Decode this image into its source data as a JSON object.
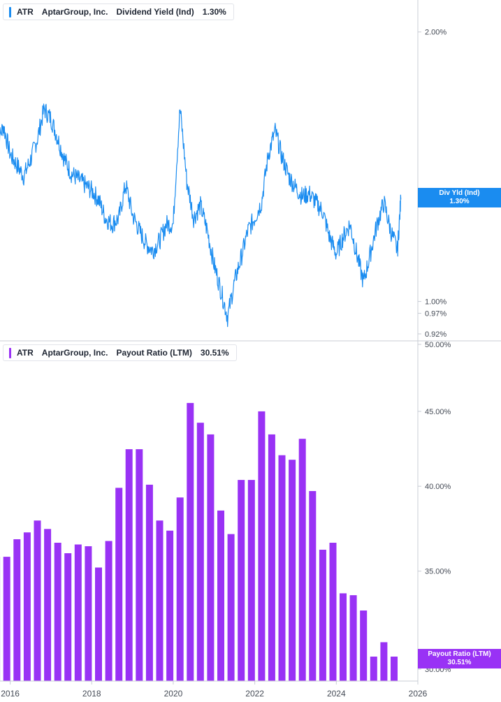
{
  "colors": {
    "yield": "#1a8cf0",
    "payout": "#9932f5",
    "axis": "#c8ccd4",
    "text": "#1f2633",
    "tick_text": "#444a55"
  },
  "top_panel": {
    "ticker": "ATR",
    "company": "AptarGroup, Inc.",
    "metric": "Dividend Yield (Ind)",
    "value": "1.30%",
    "badge_line1": "Div Yld (Ind)",
    "badge_line2": "1.30%"
  },
  "bottom_panel": {
    "ticker": "ATR",
    "company": "AptarGroup, Inc.",
    "metric": "Payout Ratio (LTM)",
    "value": "30.51%",
    "badge_line1": "Payout Ratio (LTM)",
    "badge_line2": "30.51%"
  },
  "chart_data": [
    {
      "type": "line",
      "title": "Dividend Yield (Ind)",
      "series": [
        {
          "name": "Dividend Yield (Ind)",
          "points": [
            [
              "2015-09",
              1.5
            ],
            [
              "2015-11",
              1.57
            ],
            [
              "2016-01",
              1.46
            ],
            [
              "2016-03",
              1.42
            ],
            [
              "2016-05",
              1.38
            ],
            [
              "2016-07",
              1.44
            ],
            [
              "2016-09",
              1.52
            ],
            [
              "2016-11",
              1.64
            ],
            [
              "2017-01",
              1.6
            ],
            [
              "2017-03",
              1.52
            ],
            [
              "2017-05",
              1.44
            ],
            [
              "2017-07",
              1.39
            ],
            [
              "2017-09",
              1.37
            ],
            [
              "2017-11",
              1.35
            ],
            [
              "2018-01",
              1.33
            ],
            [
              "2018-03",
              1.3
            ],
            [
              "2018-05",
              1.24
            ],
            [
              "2018-07",
              1.22
            ],
            [
              "2018-09",
              1.24
            ],
            [
              "2018-11",
              1.35
            ],
            [
              "2019-01",
              1.25
            ],
            [
              "2019-03",
              1.2
            ],
            [
              "2019-05",
              1.16
            ],
            [
              "2019-07",
              1.14
            ],
            [
              "2019-09",
              1.17
            ],
            [
              "2019-11",
              1.22
            ],
            [
              "2020-01",
              1.22
            ],
            [
              "2020-03",
              1.64
            ],
            [
              "2020-05",
              1.36
            ],
            [
              "2020-07",
              1.24
            ],
            [
              "2020-09",
              1.28
            ],
            [
              "2020-11",
              1.2
            ],
            [
              "2021-01",
              1.1
            ],
            [
              "2021-03",
              1.03
            ],
            [
              "2021-05",
              0.96
            ],
            [
              "2021-07",
              1.05
            ],
            [
              "2021-09",
              1.12
            ],
            [
              "2021-11",
              1.2
            ],
            [
              "2022-01",
              1.24
            ],
            [
              "2022-03",
              1.29
            ],
            [
              "2022-05",
              1.46
            ],
            [
              "2022-07",
              1.55
            ],
            [
              "2022-09",
              1.45
            ],
            [
              "2022-11",
              1.38
            ],
            [
              "2023-01",
              1.34
            ],
            [
              "2023-03",
              1.31
            ],
            [
              "2023-05",
              1.32
            ],
            [
              "2023-07",
              1.29
            ],
            [
              "2023-09",
              1.26
            ],
            [
              "2023-11",
              1.18
            ],
            [
              "2024-01",
              1.13
            ],
            [
              "2024-03",
              1.18
            ],
            [
              "2024-05",
              1.22
            ],
            [
              "2024-07",
              1.13
            ],
            [
              "2024-09",
              1.05
            ],
            [
              "2024-11",
              1.13
            ],
            [
              "2025-01",
              1.22
            ],
            [
              "2025-03",
              1.29
            ],
            [
              "2025-05",
              1.2
            ],
            [
              "2025-07",
              1.14
            ],
            [
              "2025-08",
              1.3
            ]
          ]
        }
      ],
      "yscale": "log",
      "ylim": [
        0.92,
        2.05
      ],
      "ytick_labels": [
        "2.00%",
        "1.00%",
        "0.97%",
        "0.92%"
      ],
      "ytick_values": [
        2.0,
        1.0,
        0.97,
        0.92
      ],
      "grid": false
    },
    {
      "type": "bar",
      "title": "Payout Ratio (LTM)",
      "series": [
        {
          "name": "Payout Ratio (LTM)",
          "values": [
            [
              "2015-09",
              35.8
            ],
            [
              "2015-12",
              35.8
            ],
            [
              "2016-03",
              36.8
            ],
            [
              "2016-06",
              37.2
            ],
            [
              "2016-09",
              37.9
            ],
            [
              "2016-12",
              37.4
            ],
            [
              "2017-03",
              36.6
            ],
            [
              "2017-06",
              36.0
            ],
            [
              "2017-09",
              36.5
            ],
            [
              "2017-12",
              36.4
            ],
            [
              "2018-03",
              35.2
            ],
            [
              "2018-06",
              36.7
            ],
            [
              "2018-09",
              39.9
            ],
            [
              "2018-12",
              42.4
            ],
            [
              "2019-03",
              42.4
            ],
            [
              "2019-06",
              40.1
            ],
            [
              "2019-09",
              37.9
            ],
            [
              "2019-12",
              37.3
            ],
            [
              "2020-03",
              39.3
            ],
            [
              "2020-06",
              45.6
            ],
            [
              "2020-09",
              44.2
            ],
            [
              "2020-12",
              43.4
            ],
            [
              "2021-03",
              38.5
            ],
            [
              "2021-06",
              37.1
            ],
            [
              "2021-09",
              40.4
            ],
            [
              "2021-12",
              40.4
            ],
            [
              "2022-03",
              45.0
            ],
            [
              "2022-06",
              43.4
            ],
            [
              "2022-09",
              42.0
            ],
            [
              "2022-12",
              41.7
            ],
            [
              "2023-03",
              43.1
            ],
            [
              "2023-06",
              39.7
            ],
            [
              "2023-09",
              36.2
            ],
            [
              "2023-12",
              36.6
            ],
            [
              "2024-03",
              33.8
            ],
            [
              "2024-06",
              33.7
            ],
            [
              "2024-09",
              32.9
            ],
            [
              "2024-12",
              30.6
            ],
            [
              "2025-03",
              31.3
            ],
            [
              "2025-06",
              30.6
            ]
          ]
        }
      ],
      "yscale": "log",
      "ylim": [
        30.0,
        50.0
      ],
      "ytick_labels": [
        "50.00%",
        "45.00%",
        "40.00%",
        "35.00%",
        "30.00%"
      ],
      "ytick_values": [
        50.0,
        45.0,
        40.0,
        35.0,
        30.0
      ],
      "grid": false
    }
  ],
  "x_axis": {
    "tick_labels": [
      "2016",
      "2018",
      "2020",
      "2022",
      "2024",
      "2026"
    ],
    "range": [
      "2015-09",
      "2026-01"
    ]
  }
}
